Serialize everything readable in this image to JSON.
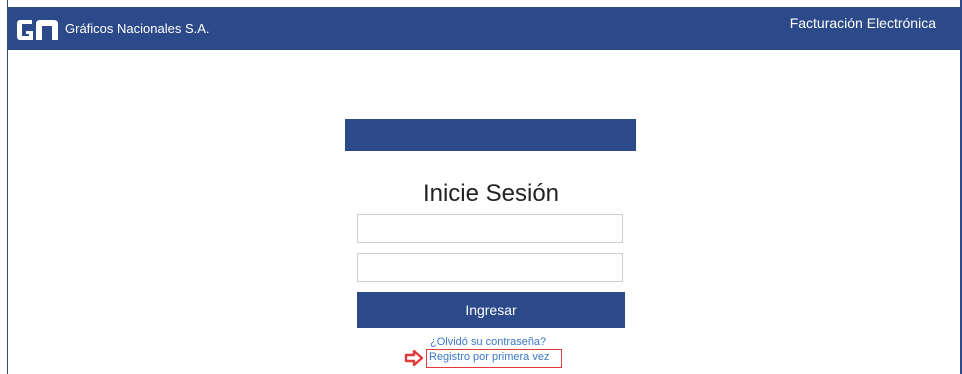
{
  "header": {
    "company_name": "Gráficos Nacionales S.A.",
    "app_title": "Facturación Electrónica",
    "logo_icon": "gn-logo-icon"
  },
  "login": {
    "title": "Inicie Sesión",
    "username_value": "",
    "username_placeholder": "",
    "password_value": "",
    "password_placeholder": "",
    "submit_label": "Ingresar",
    "forgot_link": "¿Olvidó su contraseña?",
    "register_link": "Registro por primera vez"
  },
  "annotation": {
    "arrow_icon": "red-arrow-right-icon"
  },
  "colors": {
    "brand": "#2c4a8a",
    "link": "#3a78c8",
    "highlight": "#e23b3b"
  }
}
